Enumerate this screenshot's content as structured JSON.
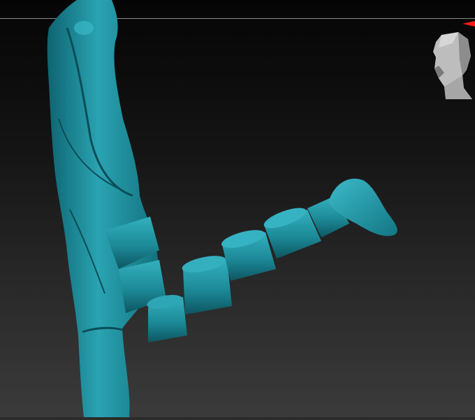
{
  "viewport": {
    "background_top": "#050505",
    "background_bottom": "#3b3b3b",
    "model_color": "#1f8c9b",
    "model_highlight": "#36b4c3",
    "model_shadow": "#0c5560",
    "axis_marker_color": "#ff1a1a"
  },
  "navigation": {
    "icon": "head-orientation-icon",
    "color": "#bdbdbd"
  }
}
